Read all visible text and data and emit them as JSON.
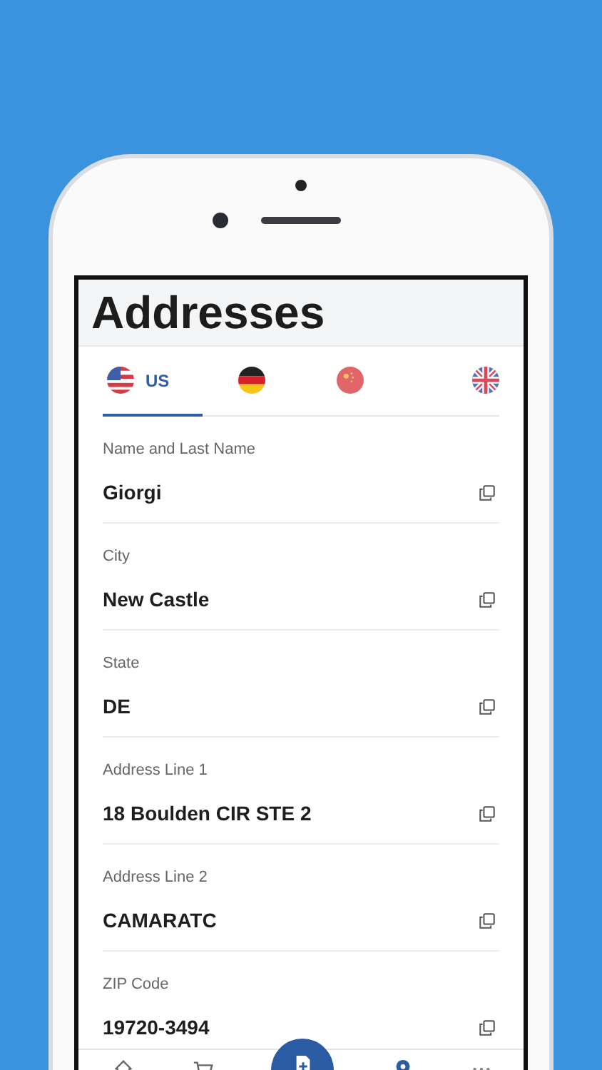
{
  "header": {
    "title": "Addresses"
  },
  "tabs": [
    {
      "kind": "us",
      "label": "US",
      "selected": true
    },
    {
      "kind": "de",
      "selected": false
    },
    {
      "kind": "cn",
      "selected": false
    },
    {
      "kind": "gb",
      "selected": false
    }
  ],
  "fields": [
    {
      "label": "Name and Last Name",
      "value": "Giorgi"
    },
    {
      "label": "City",
      "value": "New Castle"
    },
    {
      "label": "State",
      "value": "DE"
    },
    {
      "label": "Address Line 1",
      "value": "18 Boulden CIR STE 2"
    },
    {
      "label": "Address Line 2",
      "value": "CAMARATC"
    },
    {
      "label": "ZIP Code",
      "value": "19720-3494"
    }
  ],
  "bottom_nav": [
    {
      "kind": "home"
    },
    {
      "kind": "cart"
    },
    {
      "kind": "add"
    },
    {
      "kind": "pin"
    },
    {
      "kind": "more"
    }
  ]
}
